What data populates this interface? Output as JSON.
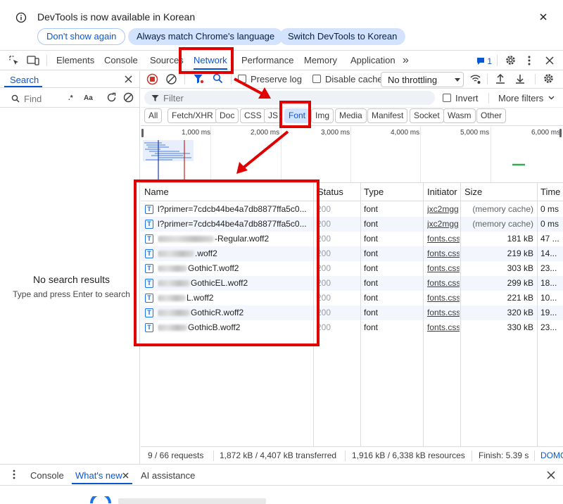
{
  "infobar": {
    "message": "DevTools is now available in Korean",
    "buttons": [
      "Don't show again",
      "Always match Chrome's language",
      "Switch DevTools to Korean"
    ],
    "info_icon": "info-icon",
    "close_icon": "close-icon"
  },
  "main_tabs": {
    "items": [
      "Elements",
      "Console",
      "Sources",
      "Network",
      "Performance",
      "Memory",
      "Application"
    ],
    "active": "Network",
    "more": "»",
    "issues_count": "1"
  },
  "search_pane": {
    "tab_label": "Search",
    "find_placeholder": "Find",
    "regex_label": ".*",
    "case_label": "Aa",
    "empty_title": "No search results",
    "empty_hint": "Type and press Enter to search"
  },
  "network_toolbar": {
    "preserve_log": "Preserve log",
    "disable_cache": "Disable cache",
    "throttling": "No throttling"
  },
  "filter_bar": {
    "placeholder": "Filter",
    "invert": "Invert",
    "more_filters": "More filters"
  },
  "type_filters": {
    "items": [
      "All",
      "Fetch/XHR",
      "Doc",
      "CSS",
      "JS",
      "Font",
      "Img",
      "Media",
      "Manifest",
      "Socket",
      "Wasm",
      "Other"
    ],
    "active": "Font"
  },
  "overview": {
    "ticks": [
      "1,000 ms",
      "2,000 ms",
      "3,000 ms",
      "4,000 ms",
      "5,000 ms",
      "6,000 ms"
    ]
  },
  "table": {
    "headers": [
      "Name",
      "Status",
      "Type",
      "Initiator",
      "Size",
      "Time"
    ],
    "rows": [
      {
        "name": "l?primer=7cdcb44be4a7db8877ffa5c0...",
        "status": "200",
        "type": "font",
        "initiator": "jxc2mgg",
        "size": "(memory cache)",
        "time": "0 ms"
      },
      {
        "name": "l?primer=7cdcb44be4a7db8877ffa5c0...",
        "status": "200",
        "type": "font",
        "initiator": "jxc2mgg",
        "size": "(memory cache)",
        "time": "0 ms"
      },
      {
        "name": "-Regular.woff2",
        "status": "200",
        "type": "font",
        "initiator": "fonts.css",
        "size": "181 kB",
        "time": "47 ..."
      },
      {
        "name": ".woff2",
        "status": "200",
        "type": "font",
        "initiator": "fonts.css",
        "size": "219 kB",
        "time": "14..."
      },
      {
        "name": "GothicT.woff2",
        "status": "200",
        "type": "font",
        "initiator": "fonts.css",
        "size": "303 kB",
        "time": "23..."
      },
      {
        "name": "GothicEL.woff2",
        "status": "200",
        "type": "font",
        "initiator": "fonts.css",
        "size": "299 kB",
        "time": "18..."
      },
      {
        "name": "L.woff2",
        "status": "200",
        "type": "font",
        "initiator": "fonts.css",
        "size": "221 kB",
        "time": "10..."
      },
      {
        "name": "GothicR.woff2",
        "status": "200",
        "type": "font",
        "initiator": "fonts.css",
        "size": "320 kB",
        "time": "19..."
      },
      {
        "name": "GothicB.woff2",
        "status": "200",
        "type": "font",
        "initiator": "fonts.css",
        "size": "330 kB",
        "time": "23..."
      }
    ]
  },
  "status_bar": {
    "requests": "9 / 66 requests",
    "transferred": "1,872 kB / 4,407 kB transferred",
    "resources": "1,916 kB / 6,338 kB resources",
    "finish": "Finish: 5.39 s",
    "dom": "DOMC"
  },
  "drawer": {
    "tabs": [
      "Console",
      "What's new",
      "AI assistance"
    ],
    "active": "What's new"
  },
  "colors": {
    "accent": "#0b57d0",
    "annotation": "#e00000"
  }
}
